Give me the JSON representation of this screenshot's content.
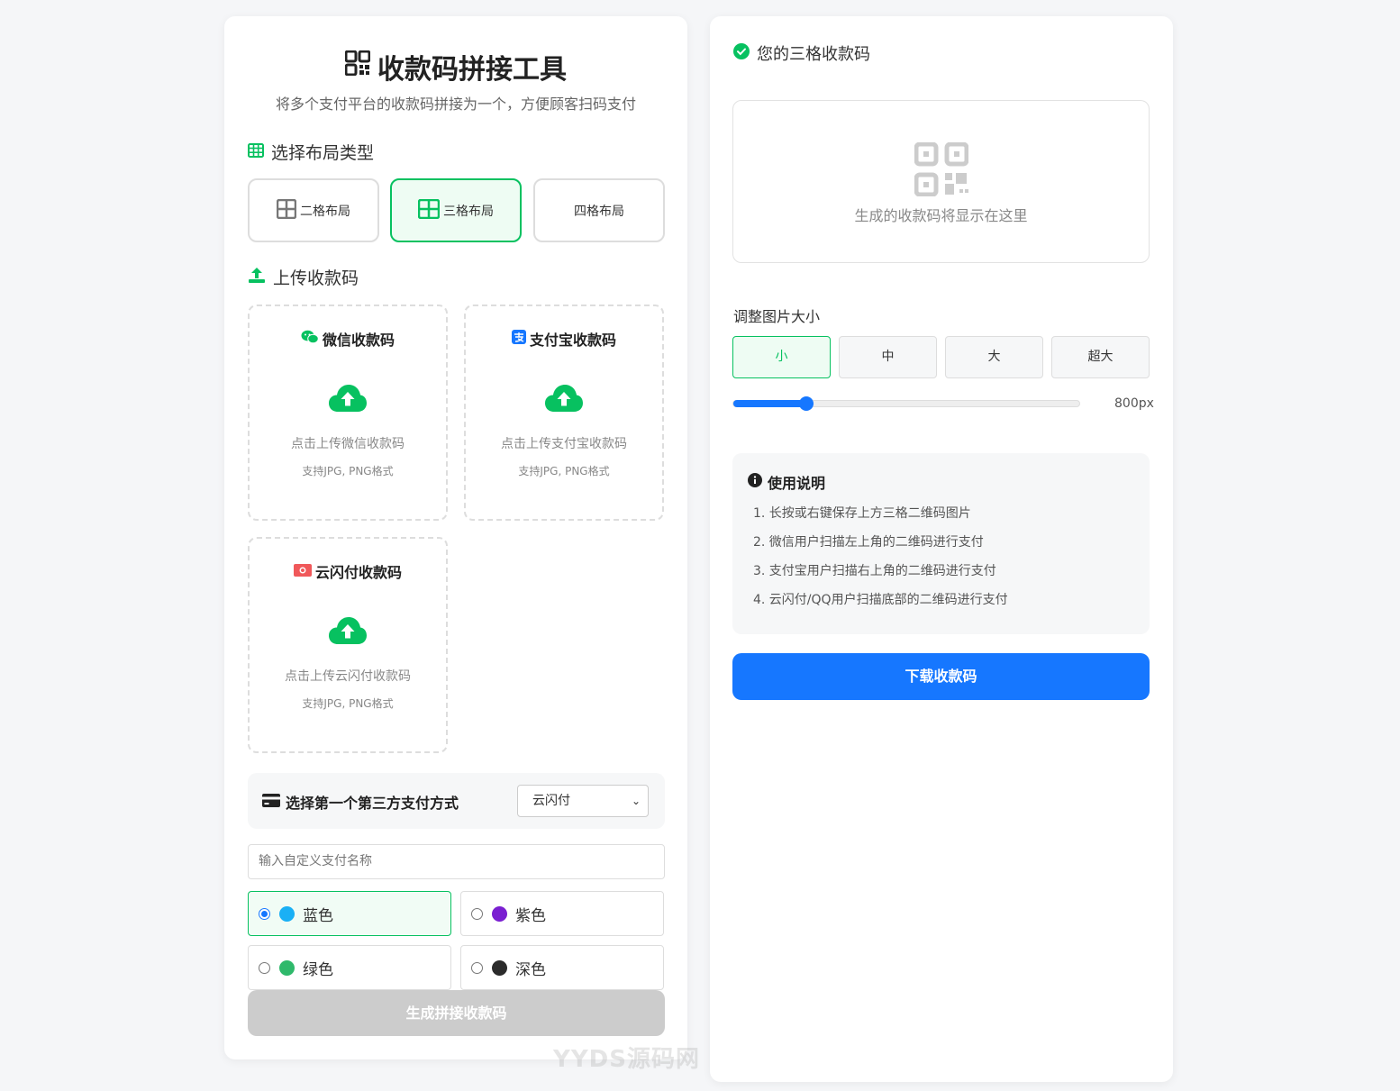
{
  "app": {
    "title": "收款码拼接工具",
    "subtitle": "将多个支付平台的收款码拼接为一个，方便顾客扫码支付"
  },
  "layout_section": {
    "label": "选择布局类型",
    "options": [
      {
        "label": "二格布局",
        "active": false
      },
      {
        "label": "三格布局",
        "active": true
      },
      {
        "label": "四格布局",
        "active": false
      }
    ]
  },
  "upload_section": {
    "label": "上传收款码",
    "boxes": [
      {
        "title": "微信收款码",
        "hint": "点击上传微信收款码",
        "format": "支持JPG, PNG格式"
      },
      {
        "title": "支付宝收款码",
        "hint": "点击上传支付宝收款码",
        "format": "支持JPG, PNG格式"
      },
      {
        "title": "云闪付收款码",
        "hint": "点击上传云闪付收款码",
        "format": "支持JPG, PNG格式"
      }
    ]
  },
  "third_party": {
    "label": "选择第一个第三方支付方式",
    "selected": "云闪付",
    "custom_placeholder": "输入自定义支付名称"
  },
  "colors": [
    {
      "label": "蓝色",
      "hex": "#1ab0f5",
      "checked": true
    },
    {
      "label": "紫色",
      "hex": "#7a1fd1",
      "checked": false
    },
    {
      "label": "绿色",
      "hex": "#2fb96b",
      "checked": false
    },
    {
      "label": "深色",
      "hex": "#2b2b2b",
      "checked": false
    }
  ],
  "generate_button": "生成拼接收款码",
  "watermark": "YYDS源码网",
  "result": {
    "title": "您的三格收款码",
    "placeholder": "生成的收款码将显示在这里"
  },
  "size": {
    "label": "调整图片大小",
    "options": [
      {
        "label": "小",
        "active": true
      },
      {
        "label": "中",
        "active": false
      },
      {
        "label": "大",
        "active": false
      },
      {
        "label": "超大",
        "active": false
      }
    ],
    "slider_fraction": 0.21,
    "value_text": "800px"
  },
  "instructions": {
    "title": "使用说明",
    "items": [
      "1. 长按或右键保存上方三格二维码图片",
      "2. 微信用户扫描左上角的二维码进行支付",
      "3. 支付宝用户扫描右上角的二维码进行支付",
      "4. 云闪付/QQ用户扫描底部的二维码进行支付"
    ]
  },
  "download_button": "下载收款码",
  "theme": {
    "green": "#07c160",
    "blue": "#1677ff"
  }
}
